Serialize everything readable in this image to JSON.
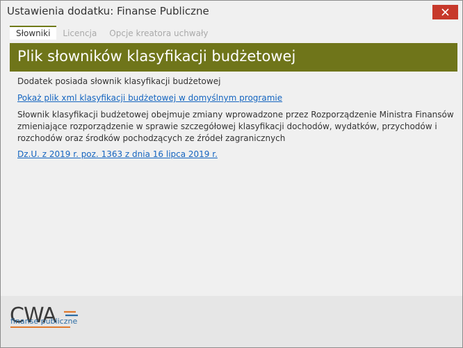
{
  "window": {
    "title": "Ustawienia dodatku: Finanse Publiczne",
    "close_icon": "close-icon",
    "close_color": "#c7392b"
  },
  "tabs": [
    {
      "label": "Słowniki",
      "active": true
    },
    {
      "label": "Licencja",
      "active": false
    },
    {
      "label": "Opcje kreatora uchwały",
      "active": false
    }
  ],
  "content": {
    "banner_title": "Plik słowników klasyfikacji budżetowej",
    "banner_color": "#6f751a",
    "status_text": "Dodatek posiada słownik klasyfikacji budżetowej",
    "show_xml_link": "Pokaż plik xml klasyfikacji budżetowej w domyślnym programie",
    "description_line1": "Słownik klasyfikacji budżetowej obejmuje zmiany wprowadzone przez Rozporządzenie Ministra Finansów",
    "description_line2": "zmieniające rozporządzenie w sprawie szczegółowej klasyfikacji dochodów, wydatków, przychodów i",
    "description_line3": "rozchodów oraz środków pochodzących ze źródeł zagranicznych",
    "legal_link": "Dz.U. z 2019 r. poz. 1363 z dnia 16 lipca 2019 r.",
    "link_color": "#1565c0"
  },
  "footer": {
    "logo_text": "CWA",
    "logo_subtitle": "finanse publiczne"
  }
}
